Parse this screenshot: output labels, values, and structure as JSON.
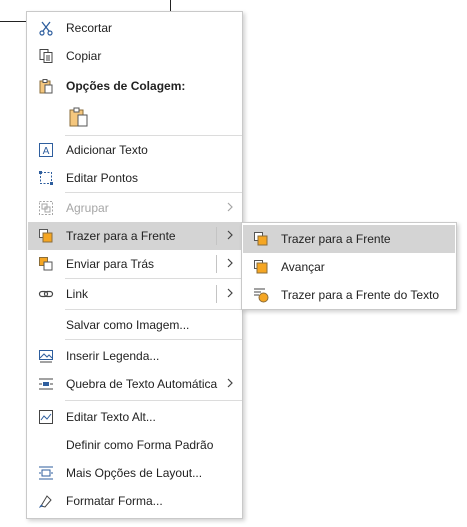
{
  "menu": {
    "items": [
      {
        "label": "Recortar",
        "icon": "scissors-icon"
      },
      {
        "label": "Copiar",
        "icon": "copy-icon"
      },
      {
        "label": "Opções de Colagem:",
        "icon": "paste-icon"
      },
      {
        "label": "",
        "icon": "paste-keep-formatting-icon"
      },
      {
        "label": "Adicionar Texto",
        "icon": "text-box-icon"
      },
      {
        "label": "Editar Pontos",
        "icon": "edit-points-icon"
      },
      {
        "label": "Agrupar",
        "icon": "group-icon"
      },
      {
        "label": "Trazer para a Frente",
        "icon": "bring-to-front-icon"
      },
      {
        "label": "Enviar para Trás",
        "icon": "send-to-back-icon"
      },
      {
        "label": "Link",
        "icon": "link-icon"
      },
      {
        "label": "Salvar como Imagem...",
        "icon": ""
      },
      {
        "label": "Inserir Legenda...",
        "icon": "caption-icon"
      },
      {
        "label": "Quebra de Texto Automática",
        "icon": "wrap-text-icon"
      },
      {
        "label": "Editar Texto Alt...",
        "icon": "alt-text-icon"
      },
      {
        "label": "Definir como Forma Padrão",
        "icon": ""
      },
      {
        "label": "Mais Opções de Layout...",
        "icon": "layout-options-icon"
      },
      {
        "label": "Formatar Forma...",
        "icon": "format-shape-icon"
      }
    ]
  },
  "submenu": {
    "items": [
      {
        "label": "Trazer para a Frente",
        "icon": "bring-to-front-icon"
      },
      {
        "label": "Avançar",
        "icon": "bring-forward-icon"
      },
      {
        "label": "Trazer para a Frente do Texto",
        "icon": "bring-in-front-of-text-icon"
      }
    ]
  },
  "colors": {
    "highlight": "#d4d4d4",
    "accent_orange": "#f5a623",
    "icon_blue": "#2e5e9e",
    "disabled": "#a6a6a6"
  }
}
